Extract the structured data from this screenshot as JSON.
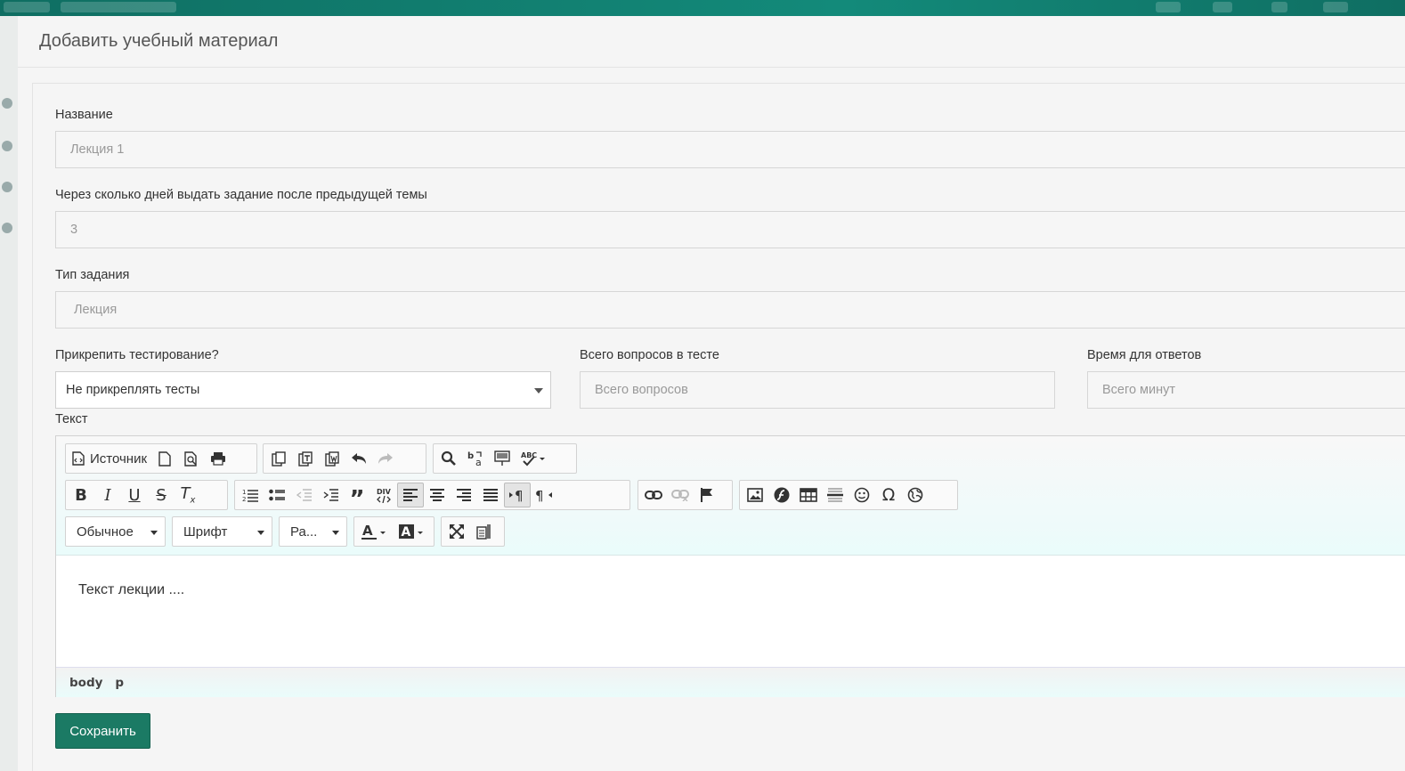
{
  "modal": {
    "title": "Добавить учебный материал"
  },
  "form": {
    "name": {
      "label": "Название",
      "value": "Лекция 1"
    },
    "days": {
      "label": "Через сколько дней выдать задание после предыдущей темы",
      "value": "3"
    },
    "type": {
      "label": "Тип задания",
      "value": "Лекция"
    },
    "attach_test": {
      "label": "Прикрепить тестирование?",
      "selected": "Не прикреплять тесты"
    },
    "total_questions": {
      "label": "Всего вопросов в тесте",
      "placeholder": "Всего вопросов"
    },
    "answer_time": {
      "label": "Время для ответов",
      "placeholder": "Всего минут"
    },
    "text": {
      "label": "Текст"
    }
  },
  "editor": {
    "source_label": "Источник",
    "format_combo": "Обычное",
    "font_combo": "Шрифт",
    "size_combo": "Ра...",
    "content": "Текст лекции ....",
    "path": [
      "body",
      "p"
    ]
  },
  "actions": {
    "save_label": "Сохранить"
  },
  "colors": {
    "accent": "#1b7a64",
    "topbar": "#138a7a"
  }
}
